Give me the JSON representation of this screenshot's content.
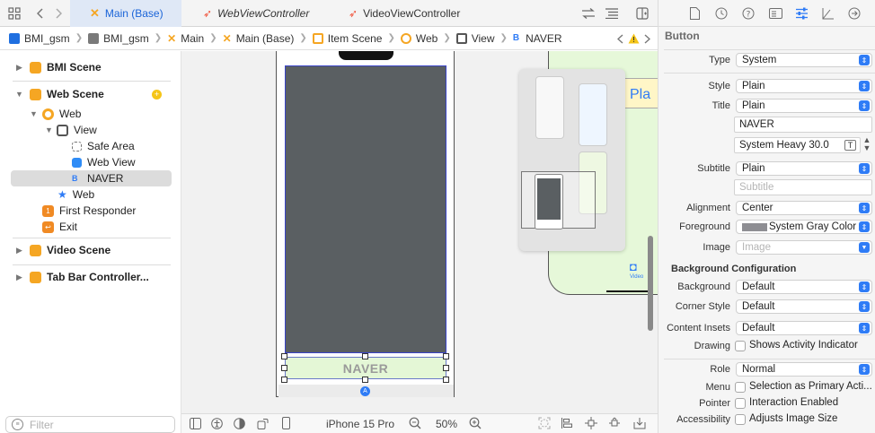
{
  "tabs": [
    {
      "label": "Main (Base)",
      "active": true
    },
    {
      "label": "WebViewController",
      "active": false
    },
    {
      "label": "VideoViewController",
      "active": false
    }
  ],
  "breadcrumbs": [
    "BMI_gsm",
    "BMI_gsm",
    "Main",
    "Main (Base)",
    "Item Scene",
    "Web",
    "View",
    "NAVER"
  ],
  "outline": {
    "bmi_scene": "BMI Scene",
    "web_scene": "Web Scene",
    "web_vc": "Web",
    "view": "View",
    "safe_area": "Safe Area",
    "web_view": "Web View",
    "naver": "NAVER",
    "web_item": "Web",
    "first_responder": "First Responder",
    "exit": "Exit",
    "video_scene": "Video Scene",
    "tab_bar": "Tab Bar Controller...",
    "filter_placeholder": "Filter"
  },
  "canvas": {
    "button_title": "NAVER",
    "mini_label": "Pla",
    "mini_video": "Video"
  },
  "bottom": {
    "device": "iPhone 15 Pro",
    "zoom": "50%"
  },
  "inspector": {
    "header": "Button",
    "type_label": "Type",
    "type_value": "System",
    "style_label": "Style",
    "style_value": "Plain",
    "title_label": "Title",
    "title_value": "Plain",
    "title_text": "NAVER",
    "font_value": "System Heavy 30.0",
    "subtitle_label": "Subtitle",
    "subtitle_value": "Plain",
    "subtitle_placeholder": "Subtitle",
    "alignment_label": "Alignment",
    "alignment_value": "Center",
    "foreground_label": "Foreground",
    "foreground_value": "System Gray Color",
    "image_label": "Image",
    "image_placeholder": "Image",
    "bg_config_header": "Background Configuration",
    "background_label": "Background",
    "background_value": "Default",
    "corner_label": "Corner Style",
    "corner_value": "Default",
    "insets_label": "Content Insets",
    "insets_value": "Default",
    "drawing_label": "Drawing",
    "drawing_check": "Shows Activity Indicator",
    "role_label": "Role",
    "role_value": "Normal",
    "menu_label": "Menu",
    "menu_check": "Selection as Primary Acti...",
    "pointer_label": "Pointer",
    "pointer_check": "Interaction Enabled",
    "accessibility_label": "Accessibility",
    "accessibility_check": "Adjusts Image Size"
  },
  "colors": {
    "accent": "#2f7cf6",
    "storyboard_icon": "#f5a623",
    "selection": "#dcdcdc",
    "webview_gray": "#5a5f62",
    "button_bg": "#e4f7d6",
    "naver_text": "#9a9a9a",
    "system_gray": "#8e8e93"
  }
}
